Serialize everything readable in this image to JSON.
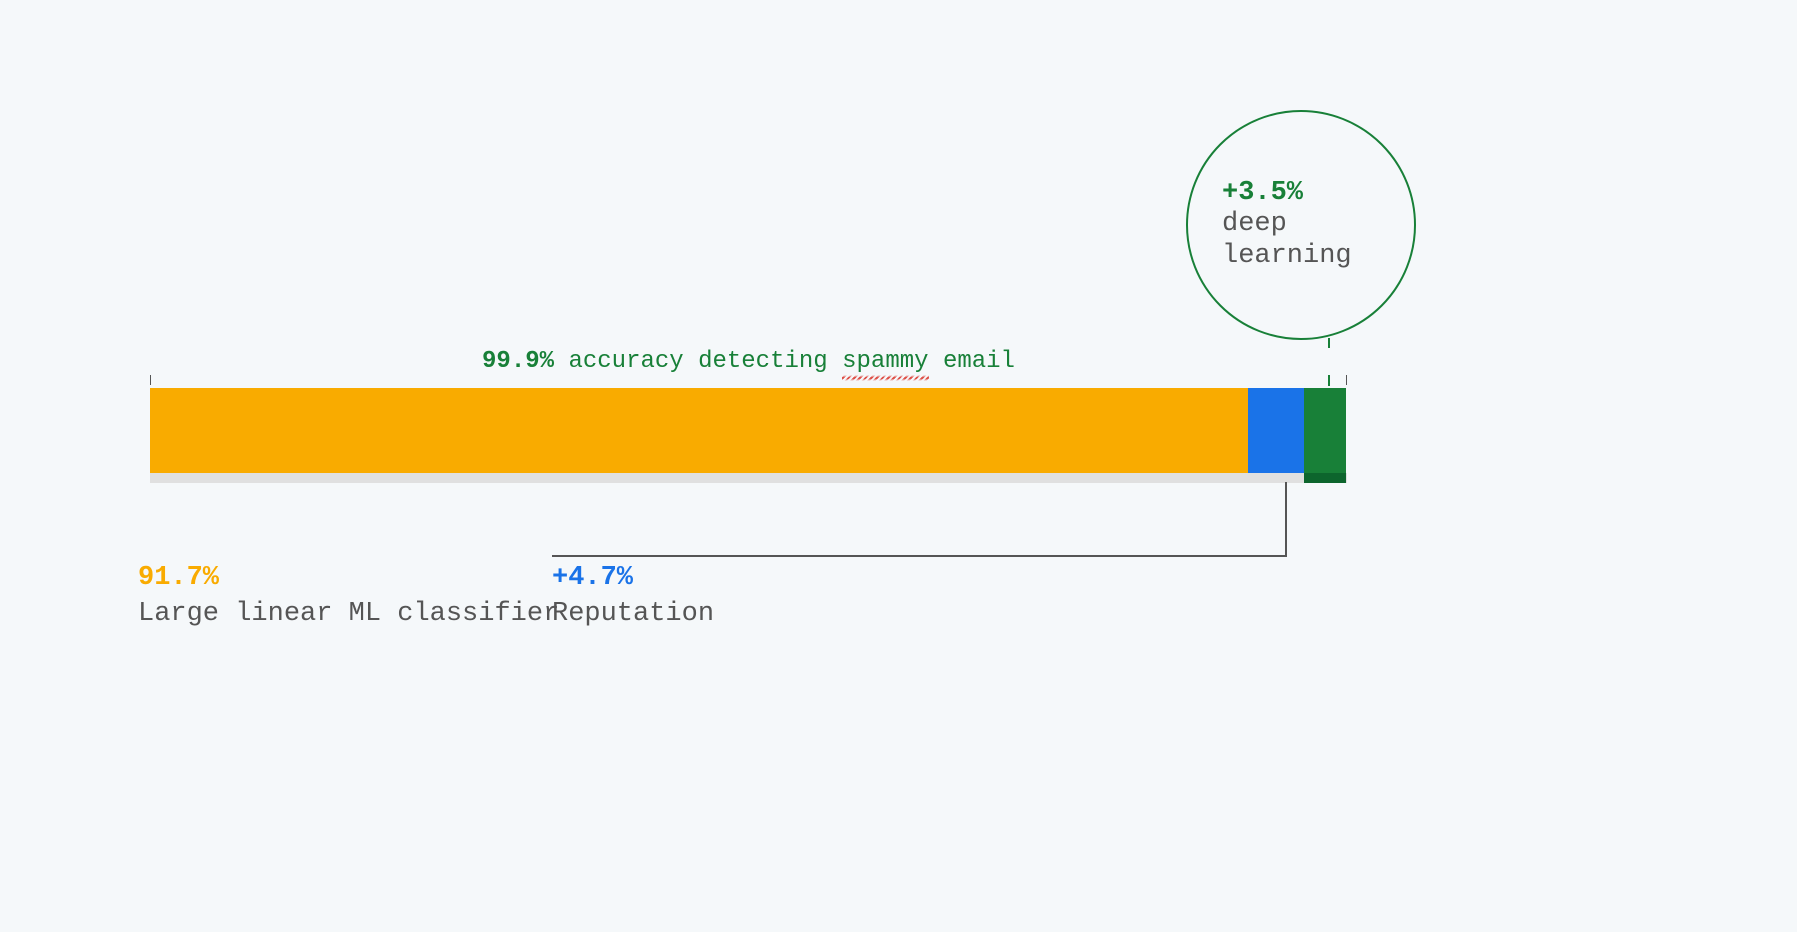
{
  "title": {
    "pct": "99.9%",
    "text_before": "accuracy detecting",
    "squiggle_word": "spammy",
    "text_after": "email"
  },
  "callout": {
    "pct": "+3.5%",
    "label_line1": "deep",
    "label_line2": "learning"
  },
  "segments": {
    "yellow": {
      "pct": "91.7%",
      "desc": "Large linear ML classifier"
    },
    "blue": {
      "pct": "+4.7%",
      "desc": "Reputation"
    }
  },
  "chart_data": {
    "type": "bar",
    "title": "99.9% accuracy detecting spammy email",
    "categories": [
      "Large linear ML classifier",
      "Reputation",
      "deep learning"
    ],
    "series": [
      {
        "name": "contribution",
        "values": [
          91.7,
          4.7,
          3.5
        ]
      }
    ],
    "xlabel": "",
    "ylabel": "",
    "total": 99.9,
    "colors": {
      "Large linear ML classifier": "#f9ab00",
      "Reputation": "#1a73e8",
      "deep learning": "#188038"
    }
  }
}
